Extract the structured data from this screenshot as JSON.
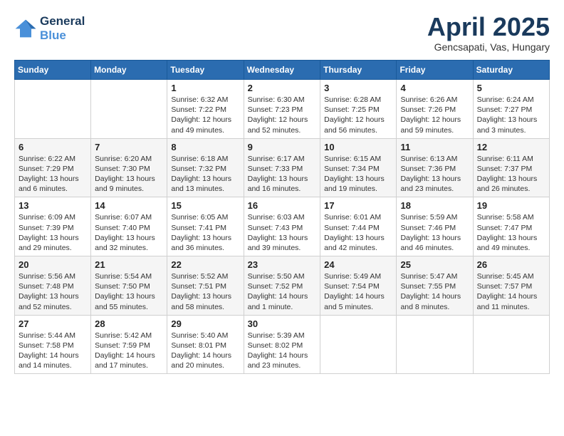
{
  "header": {
    "logo_line1": "General",
    "logo_line2": "Blue",
    "month": "April 2025",
    "location": "Gencsapati, Vas, Hungary"
  },
  "weekdays": [
    "Sunday",
    "Monday",
    "Tuesday",
    "Wednesday",
    "Thursday",
    "Friday",
    "Saturday"
  ],
  "weeks": [
    [
      {
        "day": "",
        "info": ""
      },
      {
        "day": "",
        "info": ""
      },
      {
        "day": "1",
        "info": "Sunrise: 6:32 AM\nSunset: 7:22 PM\nDaylight: 12 hours\nand 49 minutes."
      },
      {
        "day": "2",
        "info": "Sunrise: 6:30 AM\nSunset: 7:23 PM\nDaylight: 12 hours\nand 52 minutes."
      },
      {
        "day": "3",
        "info": "Sunrise: 6:28 AM\nSunset: 7:25 PM\nDaylight: 12 hours\nand 56 minutes."
      },
      {
        "day": "4",
        "info": "Sunrise: 6:26 AM\nSunset: 7:26 PM\nDaylight: 12 hours\nand 59 minutes."
      },
      {
        "day": "5",
        "info": "Sunrise: 6:24 AM\nSunset: 7:27 PM\nDaylight: 13 hours\nand 3 minutes."
      }
    ],
    [
      {
        "day": "6",
        "info": "Sunrise: 6:22 AM\nSunset: 7:29 PM\nDaylight: 13 hours\nand 6 minutes."
      },
      {
        "day": "7",
        "info": "Sunrise: 6:20 AM\nSunset: 7:30 PM\nDaylight: 13 hours\nand 9 minutes."
      },
      {
        "day": "8",
        "info": "Sunrise: 6:18 AM\nSunset: 7:32 PM\nDaylight: 13 hours\nand 13 minutes."
      },
      {
        "day": "9",
        "info": "Sunrise: 6:17 AM\nSunset: 7:33 PM\nDaylight: 13 hours\nand 16 minutes."
      },
      {
        "day": "10",
        "info": "Sunrise: 6:15 AM\nSunset: 7:34 PM\nDaylight: 13 hours\nand 19 minutes."
      },
      {
        "day": "11",
        "info": "Sunrise: 6:13 AM\nSunset: 7:36 PM\nDaylight: 13 hours\nand 23 minutes."
      },
      {
        "day": "12",
        "info": "Sunrise: 6:11 AM\nSunset: 7:37 PM\nDaylight: 13 hours\nand 26 minutes."
      }
    ],
    [
      {
        "day": "13",
        "info": "Sunrise: 6:09 AM\nSunset: 7:39 PM\nDaylight: 13 hours\nand 29 minutes."
      },
      {
        "day": "14",
        "info": "Sunrise: 6:07 AM\nSunset: 7:40 PM\nDaylight: 13 hours\nand 32 minutes."
      },
      {
        "day": "15",
        "info": "Sunrise: 6:05 AM\nSunset: 7:41 PM\nDaylight: 13 hours\nand 36 minutes."
      },
      {
        "day": "16",
        "info": "Sunrise: 6:03 AM\nSunset: 7:43 PM\nDaylight: 13 hours\nand 39 minutes."
      },
      {
        "day": "17",
        "info": "Sunrise: 6:01 AM\nSunset: 7:44 PM\nDaylight: 13 hours\nand 42 minutes."
      },
      {
        "day": "18",
        "info": "Sunrise: 5:59 AM\nSunset: 7:46 PM\nDaylight: 13 hours\nand 46 minutes."
      },
      {
        "day": "19",
        "info": "Sunrise: 5:58 AM\nSunset: 7:47 PM\nDaylight: 13 hours\nand 49 minutes."
      }
    ],
    [
      {
        "day": "20",
        "info": "Sunrise: 5:56 AM\nSunset: 7:48 PM\nDaylight: 13 hours\nand 52 minutes."
      },
      {
        "day": "21",
        "info": "Sunrise: 5:54 AM\nSunset: 7:50 PM\nDaylight: 13 hours\nand 55 minutes."
      },
      {
        "day": "22",
        "info": "Sunrise: 5:52 AM\nSunset: 7:51 PM\nDaylight: 13 hours\nand 58 minutes."
      },
      {
        "day": "23",
        "info": "Sunrise: 5:50 AM\nSunset: 7:52 PM\nDaylight: 14 hours\nand 1 minute."
      },
      {
        "day": "24",
        "info": "Sunrise: 5:49 AM\nSunset: 7:54 PM\nDaylight: 14 hours\nand 5 minutes."
      },
      {
        "day": "25",
        "info": "Sunrise: 5:47 AM\nSunset: 7:55 PM\nDaylight: 14 hours\nand 8 minutes."
      },
      {
        "day": "26",
        "info": "Sunrise: 5:45 AM\nSunset: 7:57 PM\nDaylight: 14 hours\nand 11 minutes."
      }
    ],
    [
      {
        "day": "27",
        "info": "Sunrise: 5:44 AM\nSunset: 7:58 PM\nDaylight: 14 hours\nand 14 minutes."
      },
      {
        "day": "28",
        "info": "Sunrise: 5:42 AM\nSunset: 7:59 PM\nDaylight: 14 hours\nand 17 minutes."
      },
      {
        "day": "29",
        "info": "Sunrise: 5:40 AM\nSunset: 8:01 PM\nDaylight: 14 hours\nand 20 minutes."
      },
      {
        "day": "30",
        "info": "Sunrise: 5:39 AM\nSunset: 8:02 PM\nDaylight: 14 hours\nand 23 minutes."
      },
      {
        "day": "",
        "info": ""
      },
      {
        "day": "",
        "info": ""
      },
      {
        "day": "",
        "info": ""
      }
    ]
  ]
}
